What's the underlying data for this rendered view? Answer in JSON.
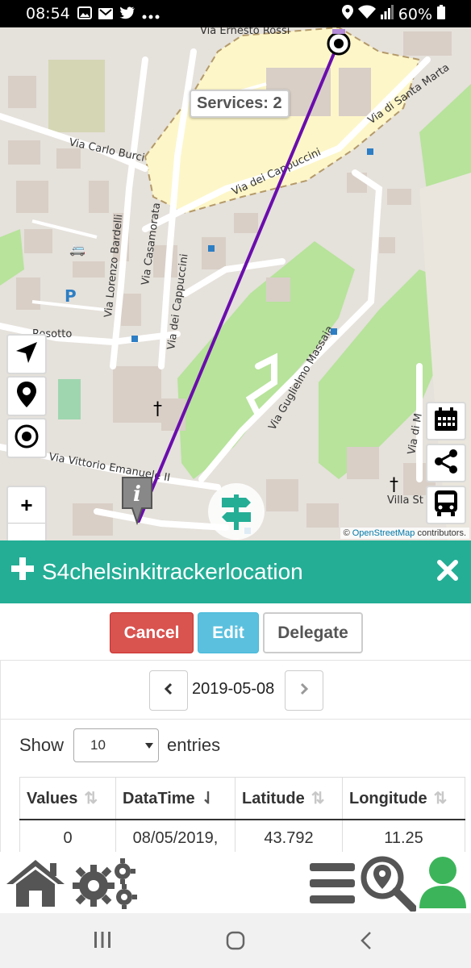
{
  "status_bar": {
    "time": "08:54",
    "battery": "60%",
    "notification_icons": [
      "image-icon",
      "mail-icon",
      "twitter-icon",
      "more-dots-icon"
    ],
    "system_icons": [
      "location-icon",
      "wifi-icon",
      "signal-icon",
      "battery-icon"
    ]
  },
  "map": {
    "services_tooltip": "Services: 2",
    "streets": [
      "Via Ernesto Rossi",
      "Via Carlo Burci",
      "Via Lorenzo Bardelli",
      "Via Casamorata",
      "Via dei Cappuccini",
      "Via di Santa Marta",
      "Via Guglielmo Massaia",
      "Via Vittorio Emanuele II",
      "Villa St",
      "Via di M",
      "Rosotto"
    ],
    "attribution_prefix": "©",
    "attribution_link": "OpenStreetMap",
    "attribution_suffix": "contributors.",
    "colors": {
      "route": "#6a0dad",
      "park": "#b7e39b",
      "campus": "#fdf6c8",
      "road": "#ffffff"
    },
    "controls_left": [
      "navigate-icon",
      "map-pin-icon",
      "locate-target-icon"
    ],
    "controls_right": [
      "calendar-icon",
      "share-icon",
      "bus-icon"
    ],
    "zoom_in": "+",
    "zoom_out": "−"
  },
  "header": {
    "title": "S4chelsinkitrackerlocation",
    "accent": "#24ae96"
  },
  "actions": {
    "cancel": "Cancel",
    "edit": "Edit",
    "delegate": "Delegate"
  },
  "date_nav": {
    "date": "2019-05-08"
  },
  "table": {
    "show_label": "Show",
    "entries_label": "entries",
    "page_size": "10",
    "columns": [
      "Values",
      "DataTime",
      "Latitude",
      "Longitude"
    ],
    "rows": [
      [
        "0",
        "08/05/2019,",
        "43.792",
        "11.25"
      ]
    ]
  },
  "toolbar": {
    "icons": [
      "home-icon",
      "settings-gears-icon",
      "menu-icon",
      "map-search-icon",
      "user-icon"
    ]
  }
}
